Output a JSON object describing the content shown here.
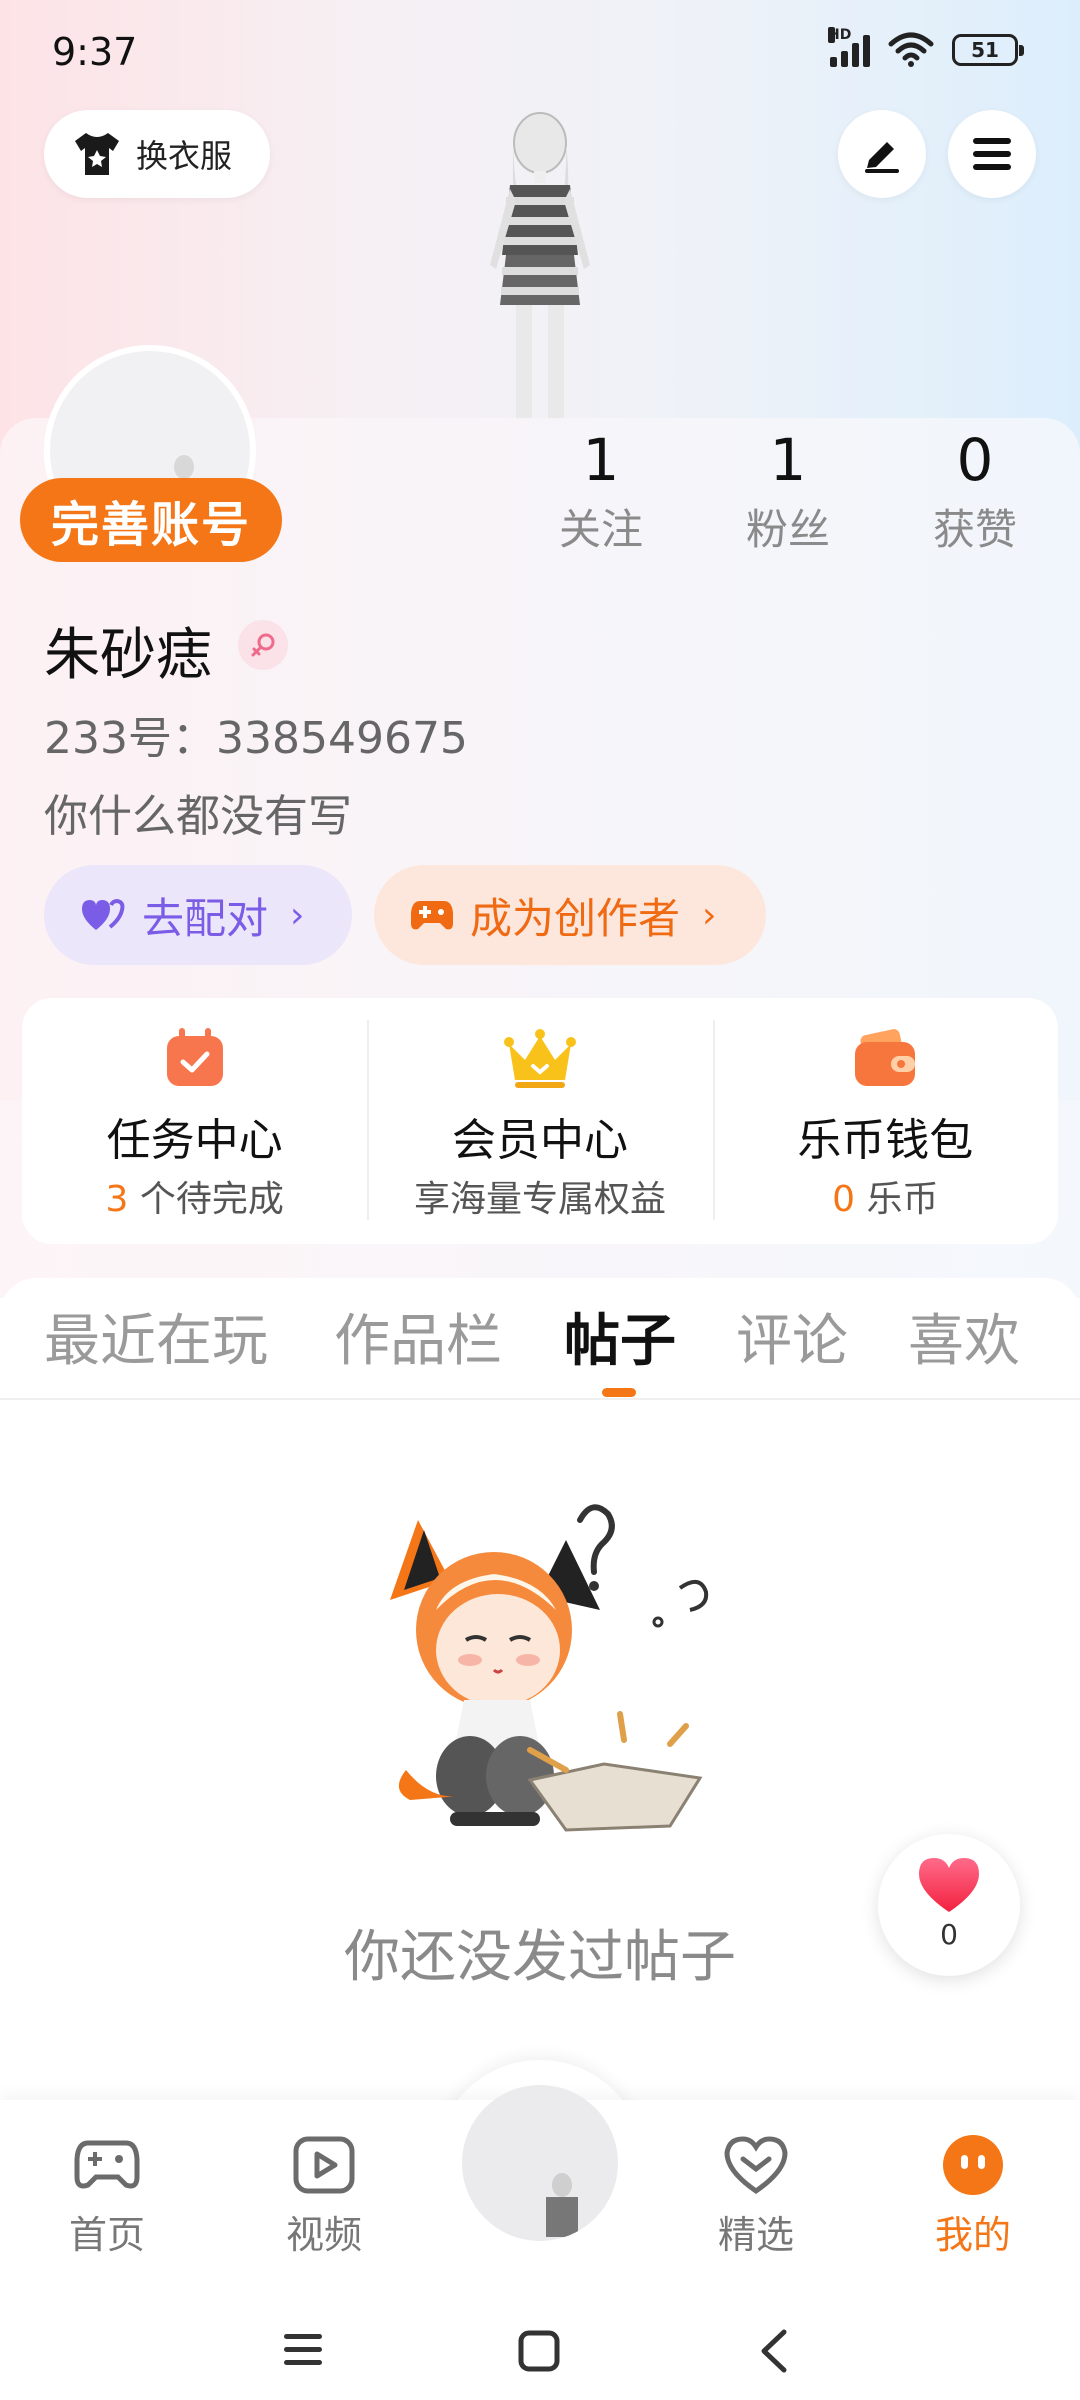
{
  "status_bar": {
    "time": "9:37",
    "hd": "HD",
    "battery": "51"
  },
  "header": {
    "dress_label": "换衣服"
  },
  "profile": {
    "complete_label": "完善账号",
    "stats": [
      {
        "num": "1",
        "label": "关注"
      },
      {
        "num": "1",
        "label": "粉丝"
      },
      {
        "num": "0",
        "label": "获赞"
      }
    ],
    "username": "朱砂痣",
    "uid": "233号：338549675",
    "bio": "你什么都没有写",
    "pair_label": "去配对",
    "creator_label": "成为创作者"
  },
  "features": [
    {
      "title": "任务中心",
      "accent": "3",
      "sub": " 个待完成"
    },
    {
      "title": "会员中心",
      "sub": "享海量专属权益"
    },
    {
      "title": "乐币钱包",
      "accent": "0",
      "sub": " 乐币"
    }
  ],
  "tabs": [
    "最近在玩",
    "作品栏",
    "帖子",
    "评论",
    "喜欢"
  ],
  "active_tab": "帖子",
  "empty_state": {
    "text": "你还没发过帖子"
  },
  "like_fab": {
    "count": "0"
  },
  "bottom_nav": [
    {
      "label": "首页",
      "icon": "gamepad-icon"
    },
    {
      "label": "视频",
      "icon": "video-play-icon"
    },
    {
      "label": "精选",
      "icon": "heart-badge-icon"
    },
    {
      "label": "我的",
      "icon": "me-face-icon"
    }
  ],
  "colors": {
    "accent": "#f47616",
    "purple": "#7a5ce6",
    "pink_bg": "#fde3e6",
    "blue_bg": "#dceefc"
  }
}
